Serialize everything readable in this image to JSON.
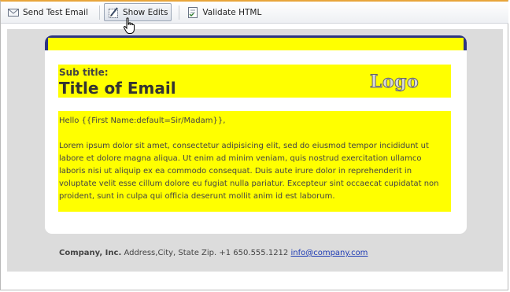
{
  "toolbar": {
    "buttons": [
      {
        "label": "Send Test Email",
        "icon": "send-email-icon"
      },
      {
        "label": "Show Edits",
        "icon": "show-edits-icon",
        "active": true
      },
      {
        "label": "Validate HTML",
        "icon": "validate-html-icon"
      }
    ]
  },
  "email": {
    "subtitle": "Sub title:",
    "title": "Title of Email",
    "logo": "Logo",
    "greeting": "Hello {{First Name:default=Sir/Madam}},",
    "body": "Lorem ipsum dolor sit amet, consectetur adipisicing elit, sed do eiusmod tempor incididunt ut labore et dolore magna aliqua. Ut enim ad minim veniam, quis nostrud exercitation ullamco laboris nisi ut aliquip ex ea commodo consequat. Duis aute irure dolor in reprehenderit in voluptate velit esse cillum dolore eu fugiat nulla pariatur. Excepteur sint occaecat cupidatat non proident, sunt in culpa qui officia deserunt mollit anim id est laborum.",
    "footer": {
      "company": "Company, Inc.",
      "address": "Address,City, State Zip. +1 650.555.1212",
      "email": "info@company.com"
    }
  },
  "colors": {
    "highlight": "#ffff00",
    "band": "#2e3582",
    "canvas": "#dcdcdc",
    "link": "#1f3cb4"
  }
}
